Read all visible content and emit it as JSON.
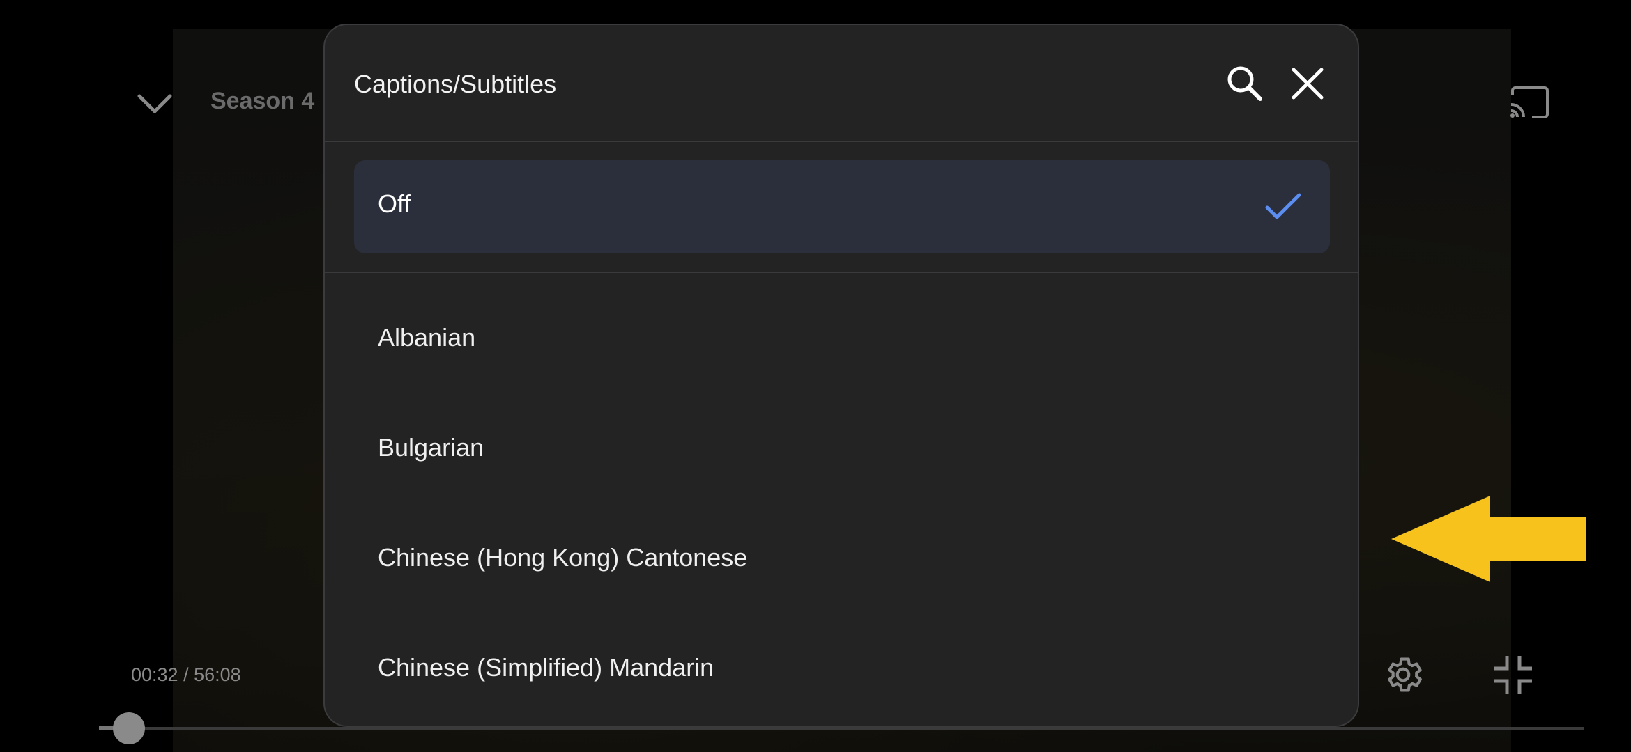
{
  "player": {
    "title": "Season 4",
    "time_display": "00:32 / 56:08",
    "progress": 0.0095
  },
  "modal": {
    "title": "Captions/Subtitles",
    "selected_option": "Off",
    "options": [
      {
        "label": "Off",
        "selected": true
      },
      {
        "label": "Albanian",
        "selected": false
      },
      {
        "label": "Bulgarian",
        "selected": false
      },
      {
        "label": "Chinese (Hong Kong) Cantonese",
        "selected": false
      },
      {
        "label": "Chinese (Simplified) Mandarin",
        "selected": false
      }
    ]
  },
  "colors": {
    "accent_check": "#5b8ef0",
    "annotation_arrow": "#f7c21c",
    "modal_bg": "#232324",
    "selected_bg": "#2b2e3b"
  },
  "icons": [
    "chevron-down-icon",
    "cast-icon",
    "search-icon",
    "close-icon",
    "checkmark-icon",
    "settings-gear-icon",
    "exit-fullscreen-icon",
    "arrow-left-annotation"
  ]
}
